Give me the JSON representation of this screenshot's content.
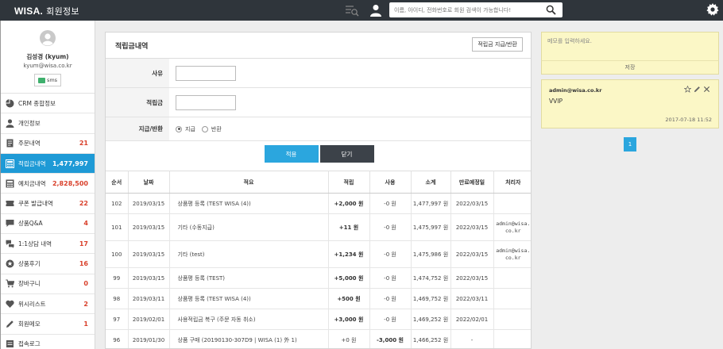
{
  "app": {
    "logo": "WISA.",
    "title": "회원정보"
  },
  "header": {
    "search_placeholder": "이름, 아이디, 전화번호로 회원 검색이 가능합니다!"
  },
  "profile": {
    "name": "김성경 (kyum)",
    "email": "kyum@wisa.co.kr",
    "sms_label": "sms"
  },
  "sidebar": {
    "items": [
      {
        "label": "CRM 종합정보",
        "count": ""
      },
      {
        "label": "개인정보",
        "count": ""
      },
      {
        "label": "주문내역",
        "count": "21"
      },
      {
        "label": "적립금내역",
        "count": "1,477,997"
      },
      {
        "label": "예치금내역",
        "count": "2,828,500"
      },
      {
        "label": "쿠폰 발급내역",
        "count": "22"
      },
      {
        "label": "상품Q&A",
        "count": "4"
      },
      {
        "label": "1:1상담 내역",
        "count": "17"
      },
      {
        "label": "상품후기",
        "count": "16"
      },
      {
        "label": "장바구니",
        "count": "0"
      },
      {
        "label": "위시리스트",
        "count": "2"
      },
      {
        "label": "회원메모",
        "count": "1"
      },
      {
        "label": "접속로그",
        "count": ""
      }
    ]
  },
  "panel": {
    "title": "적립금내역",
    "top_button": "적립금 지급/반환",
    "form": {
      "reason_label": "사유",
      "amount_label": "적립금",
      "type_label": "지급/반환",
      "option_pay": "지급",
      "option_return": "반환"
    },
    "apply_label": "적용",
    "close_label": "닫기",
    "table": {
      "headers": [
        "순서",
        "날짜",
        "적요",
        "적립",
        "사용",
        "소계",
        "만료예정일",
        "처리자"
      ],
      "rows": [
        {
          "no": "102",
          "date": "2019/03/15",
          "memo": "상품평 등록 (TEST WISA (4))",
          "earn": "+2,000 원",
          "use": "-0 원",
          "subtotal": "1,477,997 원",
          "expire": "2022/03/15",
          "handler": ""
        },
        {
          "no": "101",
          "date": "2019/03/15",
          "memo": "기타 (수동지급)",
          "earn": "+11 원",
          "use": "-0 원",
          "subtotal": "1,475,997 원",
          "expire": "2022/03/15",
          "handler": "admin@wisa.co.kr"
        },
        {
          "no": "100",
          "date": "2019/03/15",
          "memo": "기타 (test)",
          "earn": "+1,234 원",
          "use": "-0 원",
          "subtotal": "1,475,986 원",
          "expire": "2022/03/15",
          "handler": "admin@wisa.co.kr"
        },
        {
          "no": "99",
          "date": "2019/03/15",
          "memo": "상품평 등록 (TEST)",
          "earn": "+5,000 원",
          "use": "-0 원",
          "subtotal": "1,474,752 원",
          "expire": "2022/03/15",
          "handler": ""
        },
        {
          "no": "98",
          "date": "2019/03/11",
          "memo": "상품평 등록 (TEST WISA (4))",
          "earn": "+500 원",
          "use": "-0 원",
          "subtotal": "1,469,752 원",
          "expire": "2022/03/11",
          "handler": ""
        },
        {
          "no": "97",
          "date": "2019/02/01",
          "memo": "사용적립금 복구 (주문 자동 취소)",
          "earn": "+3,000 원",
          "use": "-0 원",
          "subtotal": "1,469,252 원",
          "expire": "2022/02/01",
          "handler": ""
        },
        {
          "no": "96",
          "date": "2019/01/30",
          "memo": "상품 구매 (20190130-307D9 | WISA (1) 外 1)",
          "earn": "+0 원",
          "use": "-3,000 원",
          "subtotal": "1,466,252 원",
          "expire": "-",
          "handler": ""
        }
      ]
    }
  },
  "memo": {
    "placeholder": "메모를 입력하세요.",
    "save_label": "저장",
    "author": "admin@wisa.co.kr",
    "text": "VVIP",
    "date": "2017-07-18 11:52"
  },
  "pagination": {
    "current": "1"
  },
  "colors": {
    "accent": "#1e9ad6",
    "topbar": "#2f353b",
    "count_red": "#d9402b",
    "memo_bg": "#fbf7c6"
  }
}
